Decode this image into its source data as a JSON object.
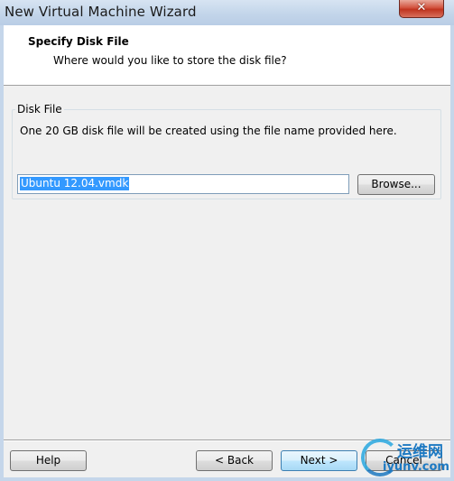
{
  "window": {
    "title": "New Virtual Machine Wizard",
    "close_symbol": "✕"
  },
  "header": {
    "title": "Specify Disk File",
    "subtitle": "Where would you like to store the disk file?"
  },
  "disk_file": {
    "group_label": "Disk File",
    "description": "One 20 GB disk file will be created using the file name provided here.",
    "filename_value": "Ubuntu 12.04.vmdk",
    "browse_label": "Browse..."
  },
  "footer": {
    "help_label": "Help",
    "back_label": "< Back",
    "next_label": "Next >",
    "cancel_label": "Cancel"
  },
  "watermark": {
    "cn_text": "运维网",
    "en_text": "iyunv.com"
  },
  "colors": {
    "selection": "#3399ff",
    "close_button": "#c0341f",
    "default_button_border": "#3c7fb1",
    "watermark": "#1d79c2"
  }
}
